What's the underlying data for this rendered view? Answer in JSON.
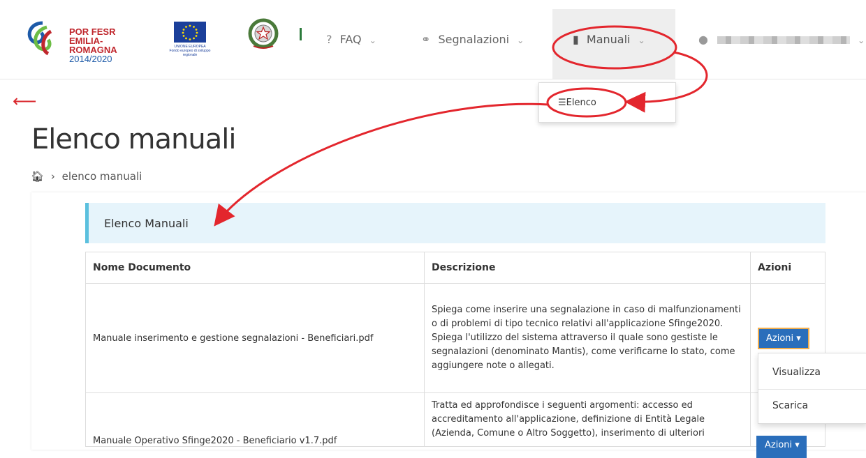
{
  "header": {
    "por_logo": {
      "line1": "POR FESR",
      "line2": "EMILIA-ROMAGNA",
      "line3": "2014/2020"
    },
    "eu_logo": {
      "line1": "UNIONE EUROPEA",
      "line2": "Fondo europeo di sviluppo regionale"
    },
    "nav": {
      "faq": "FAQ",
      "segnalazioni": "Segnalazioni",
      "manuali": "Manuali"
    },
    "manuali_dropdown": {
      "item": "Elenco"
    }
  },
  "page": {
    "title": "Elenco manuali",
    "breadcrumb_current": "elenco manuali"
  },
  "section": {
    "title": "Elenco Manuali"
  },
  "table": {
    "headers": [
      "Nome Documento",
      "Descrizione",
      "Azioni"
    ],
    "rows": [
      {
        "name": "Manuale inserimento e gestione segnalazioni - Beneficiari.pdf",
        "description": "Spiega come inserire una segnalazione in caso di malfunzionamenti o di problemi di tipo tecnico relativi all'applicazione Sfinge2020. Spiega l'utilizzo del sistema attraverso il quale sono gestiste le segnalazioni (denominato Mantis), come verificarne lo stato, come aggiungere note o allegati.",
        "action": "Azioni"
      },
      {
        "name": "Manuale Operativo Sfinge2020 - Beneficiario v1.7.pdf",
        "description": "Tratta ed approfondisce i seguenti argomenti: accesso ed accreditamento all'applicazione, definizione di Entità Legale (Azienda, Comune o Altro Soggetto), inserimento di ulteriori",
        "action": "Azioni"
      }
    ]
  },
  "action_menu": {
    "view": "Visualizza",
    "download": "Scarica"
  },
  "colors": {
    "annotation_red": "#e3262d",
    "button_blue": "#2a6ebb",
    "section_bg": "#e6f4fb",
    "section_border": "#5bc0de"
  }
}
